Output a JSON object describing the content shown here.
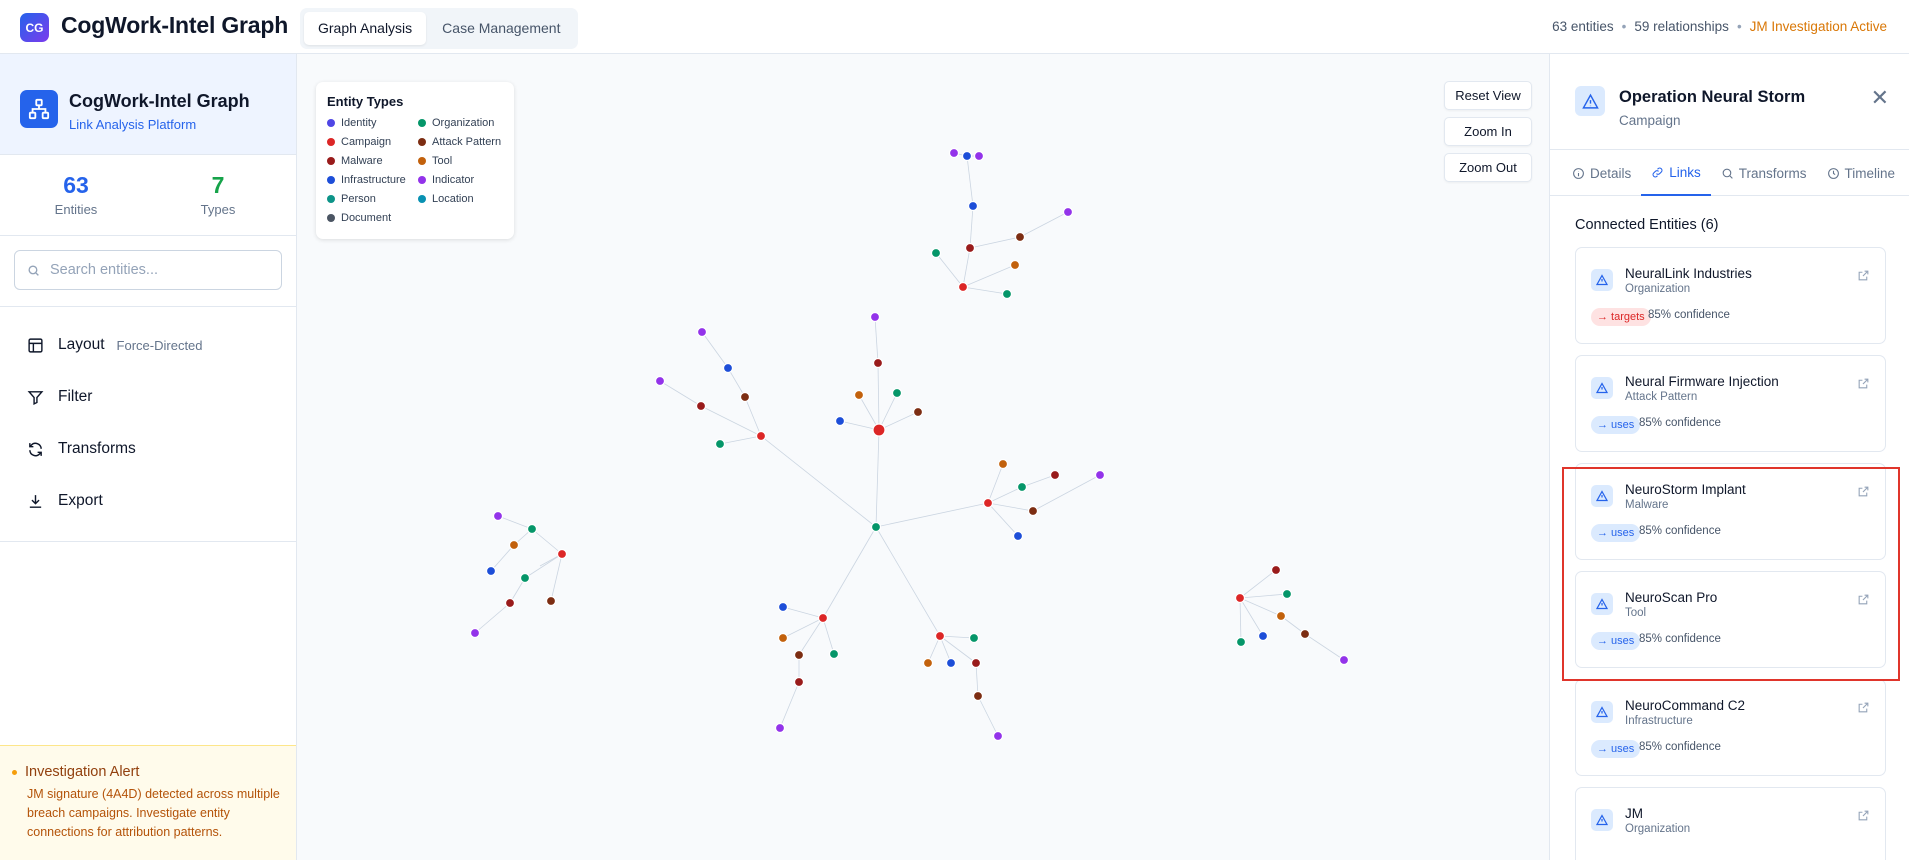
{
  "topbar": {
    "logo_text": "CG",
    "title": "CogWork-Intel Graph",
    "tabs": [
      {
        "label": "Graph Analysis",
        "active": true
      },
      {
        "label": "Case Management",
        "active": false
      }
    ],
    "stats": {
      "entities": "63 entities",
      "relationships": "59 relationships",
      "investigation": "JM Investigation Active",
      "separator": "•"
    }
  },
  "sidebar": {
    "title": "CogWork-Intel Graph",
    "subtitle": "Link Analysis Platform",
    "stats": [
      {
        "value": "63",
        "label": "Entities",
        "color": "#2563eb"
      },
      {
        "value": "7",
        "label": "Types",
        "color": "#16a34a"
      }
    ],
    "search_placeholder": "Search entities...",
    "menu": [
      {
        "label": "Layout",
        "hint": "Force-Directed",
        "icon": "layout-icon"
      },
      {
        "label": "Filter",
        "hint": "",
        "icon": "filter-icon"
      },
      {
        "label": "Transforms",
        "hint": "",
        "icon": "refresh-icon"
      },
      {
        "label": "Export",
        "hint": "",
        "icon": "download-icon"
      }
    ],
    "alert": {
      "title": "Investigation Alert",
      "text": "JM signature (4A4D) detected across multiple breach campaigns. Investigate entity connections for attribution patterns."
    }
  },
  "canvas": {
    "legend_title": "Entity Types",
    "legend": [
      {
        "label": "Identity",
        "color": "#4f46e5"
      },
      {
        "label": "Organization",
        "color": "#059669"
      },
      {
        "label": "Campaign",
        "color": "#dc2626"
      },
      {
        "label": "Attack Pattern",
        "color": "#7c2d12"
      },
      {
        "label": "Malware",
        "color": "#991b1b"
      },
      {
        "label": "Tool",
        "color": "#c2610c"
      },
      {
        "label": "Infrastructure",
        "color": "#1d4ed8"
      },
      {
        "label": "Indicator",
        "color": "#9333ea"
      },
      {
        "label": "Person",
        "color": "#0d9488"
      },
      {
        "label": "Location",
        "color": "#0891b2"
      },
      {
        "label": "Document",
        "color": "#4b5563"
      }
    ],
    "buttons": {
      "reset": "Reset View",
      "zoom_in": "Zoom In",
      "zoom_out": "Zoom Out"
    }
  },
  "panel": {
    "title": "Operation Neural Storm",
    "type": "Campaign",
    "tabs": [
      {
        "label": "Details",
        "icon": "info-icon",
        "active": false
      },
      {
        "label": "Links",
        "icon": "link-icon",
        "active": true
      },
      {
        "label": "Transforms",
        "icon": "search-icon",
        "active": false
      },
      {
        "label": "Timeline",
        "icon": "clock-icon",
        "active": false
      }
    ],
    "section_title": "Connected Entities (6)",
    "entities": [
      {
        "name": "NeuralLink Industries",
        "type": "Organization",
        "relation": "→ targets",
        "relation_kind": "targets",
        "confidence": "85% confidence"
      },
      {
        "name": "Neural Firmware Injection",
        "type": "Attack Pattern",
        "relation": "→ uses",
        "relation_kind": "uses",
        "confidence": "85% confidence"
      },
      {
        "name": "NeuroStorm Implant",
        "type": "Malware",
        "relation": "→ uses",
        "relation_kind": "uses",
        "confidence": "85% confidence"
      },
      {
        "name": "NeuroScan Pro",
        "type": "Tool",
        "relation": "→ uses",
        "relation_kind": "uses",
        "confidence": "85% confidence"
      },
      {
        "name": "NeuroCommand C2",
        "type": "Infrastructure",
        "relation": "→ uses",
        "relation_kind": "uses",
        "confidence": "85% confidence"
      },
      {
        "name": "JM",
        "type": "Organization",
        "relation": "",
        "relation_kind": "uses",
        "confidence": ""
      }
    ]
  }
}
